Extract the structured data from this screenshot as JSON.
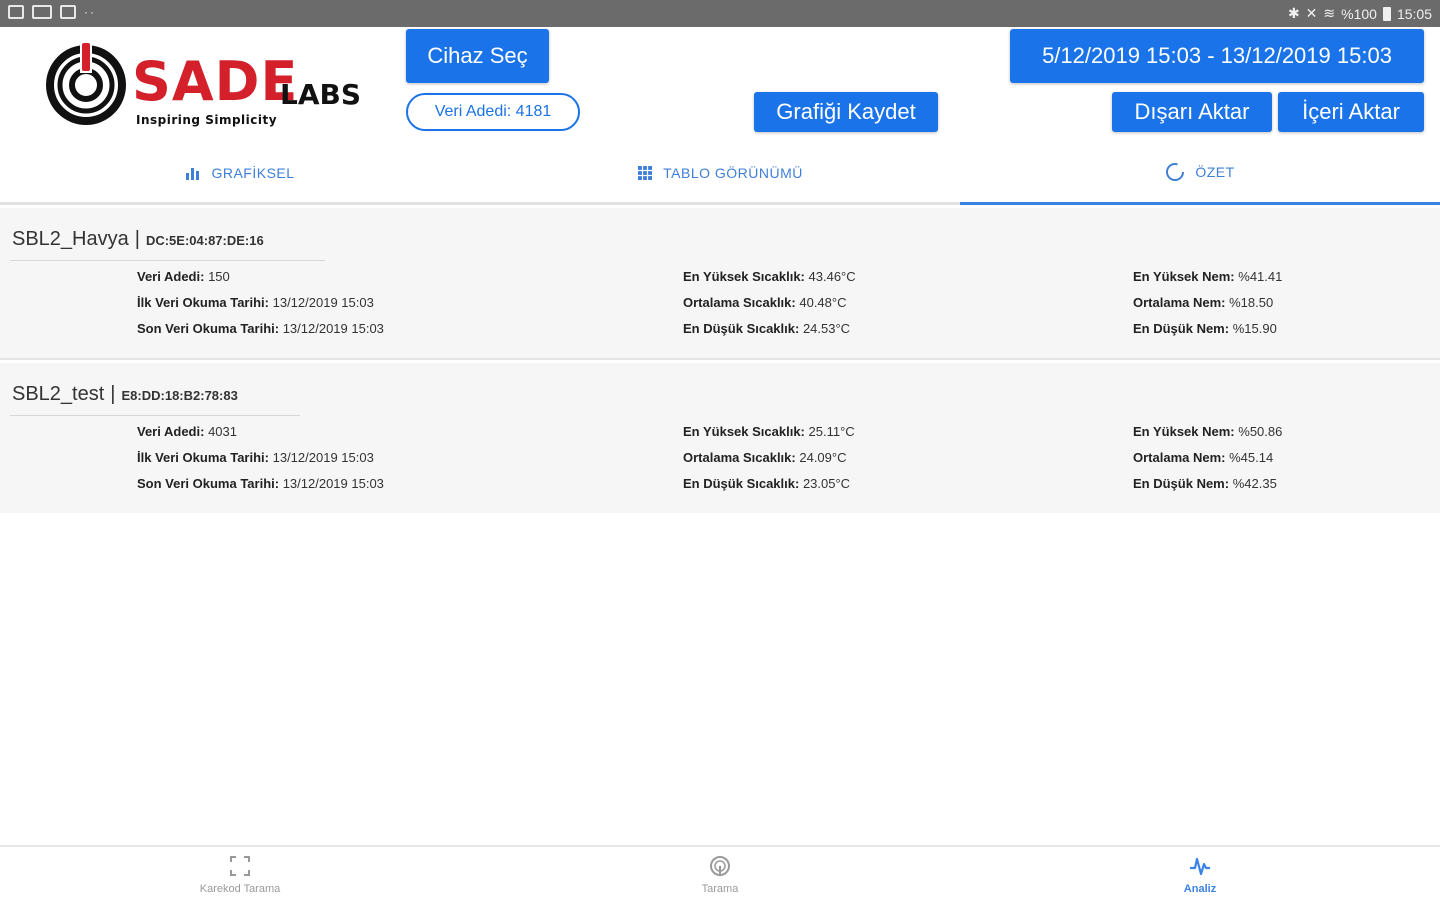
{
  "status_bar": {
    "left_icons": [
      "gallery-icon",
      "app-icon",
      "note-icon"
    ],
    "dots": "··",
    "battery": "%100",
    "time": "15:05"
  },
  "brand": {
    "name": "SADE",
    "suffix": "LABS",
    "tagline": "Inspiring Simplicity",
    "color": "#d3202a"
  },
  "header": {
    "device_select_label": "Cihaz Seç",
    "data_count_label": "Veri Adedi: 4181",
    "date_range_label": "5/12/2019 15:03 - 13/12/2019 15:03",
    "save_chart_label": "Grafiği Kaydet",
    "export_label": "Dışarı Aktar",
    "import_label": "İçeri Aktar",
    "accent_color": "#1a73e8"
  },
  "tabs": [
    {
      "label": "GRAFİKSEL",
      "icon": "bar-chart-icon",
      "active": false
    },
    {
      "label": "TABLO GÖRÜNÜMÜ",
      "icon": "table-icon",
      "active": false
    },
    {
      "label": "ÖZET",
      "icon": "circle-icon",
      "active": true
    }
  ],
  "devices": [
    {
      "name": "SBL2_Havya",
      "separator": "|",
      "mac": "DC:5E:04:87:DE:16",
      "stats_left": [
        {
          "label": "Veri Adedi:",
          "value": "150"
        },
        {
          "label": "İlk Veri Okuma Tarihi:",
          "value": "13/12/2019 15:03"
        },
        {
          "label": "Son Veri Okuma Tarihi:",
          "value": "13/12/2019 15:03"
        }
      ],
      "stats_temp": [
        {
          "label": "En Yüksek Sıcaklık:",
          "value": "43.46°C"
        },
        {
          "label": "Ortalama Sıcaklık:",
          "value": "40.48°C"
        },
        {
          "label": "En Düşük Sıcaklık:",
          "value": "24.53°C"
        }
      ],
      "stats_hum": [
        {
          "label": "En Yüksek Nem:",
          "value": "%41.41"
        },
        {
          "label": "Ortalama Nem:",
          "value": "%18.50"
        },
        {
          "label": "En Düşük Nem:",
          "value": "%15.90"
        }
      ]
    },
    {
      "name": "SBL2_test",
      "separator": "|",
      "mac": "E8:DD:18:B2:78:83",
      "stats_left": [
        {
          "label": "Veri Adedi:",
          "value": "4031"
        },
        {
          "label": "İlk Veri Okuma Tarihi:",
          "value": "13/12/2019 15:03"
        },
        {
          "label": "Son Veri Okuma Tarihi:",
          "value": "13/12/2019 15:03"
        }
      ],
      "stats_temp": [
        {
          "label": "En Yüksek Sıcaklık:",
          "value": "25.11°C"
        },
        {
          "label": "Ortalama Sıcaklık:",
          "value": "24.09°C"
        },
        {
          "label": "En Düşük Sıcaklık:",
          "value": "23.05°C"
        }
      ],
      "stats_hum": [
        {
          "label": "En Yüksek Nem:",
          "value": "%50.86"
        },
        {
          "label": "Ortalama Nem:",
          "value": "%45.14"
        },
        {
          "label": "En Düşük Nem:",
          "value": "%42.35"
        }
      ]
    }
  ],
  "bottom_nav": [
    {
      "label": "Karekod Tarama",
      "icon": "scan-icon",
      "active": false
    },
    {
      "label": "Tarama",
      "icon": "radar-icon",
      "active": false
    },
    {
      "label": "Analiz",
      "icon": "pulse-icon",
      "active": true
    }
  ]
}
